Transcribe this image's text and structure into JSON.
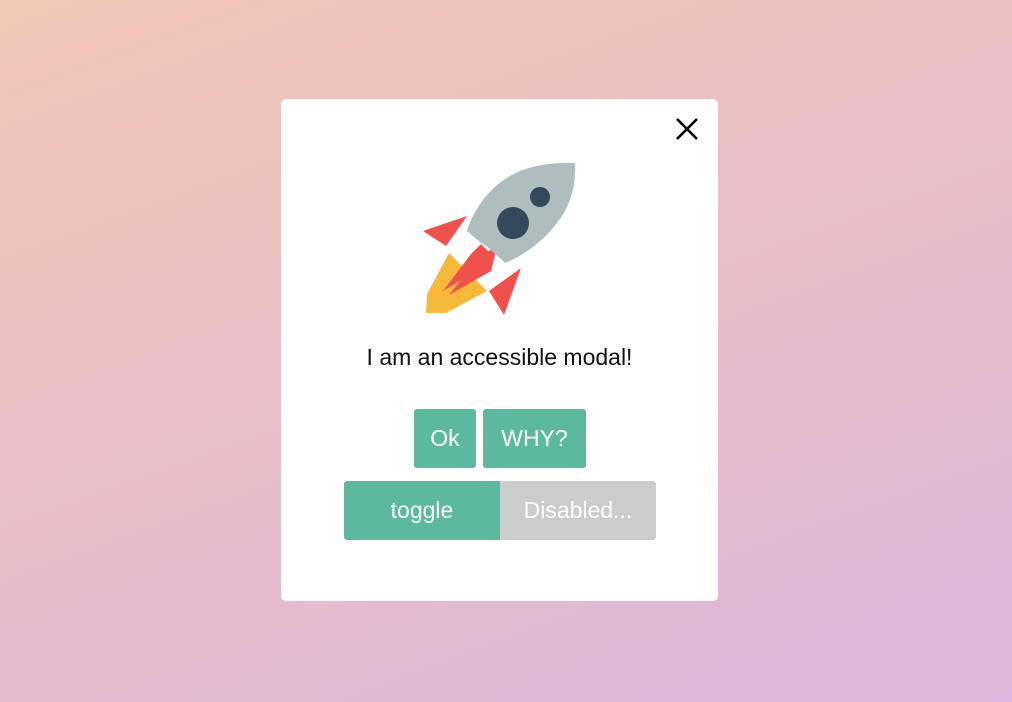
{
  "modal": {
    "close_icon": "close-icon",
    "illustration_icon": "rocket-icon",
    "message": "I am an accessible modal!",
    "buttons": {
      "ok": "Ok",
      "why": "WHY?",
      "toggle": "toggle",
      "disabled": "Disabled..."
    }
  },
  "colors": {
    "background_start": "#f0c8b6",
    "background_end": "#dcb6dc",
    "modal_bg": "#ffffff",
    "button_green": "#5cb99f",
    "button_disabled": "#cccccc",
    "rocket_body": "#afbdbf",
    "rocket_fins": "#f0514d",
    "rocket_flame": "#f6b93b",
    "rocket_windows": "#35495e"
  }
}
